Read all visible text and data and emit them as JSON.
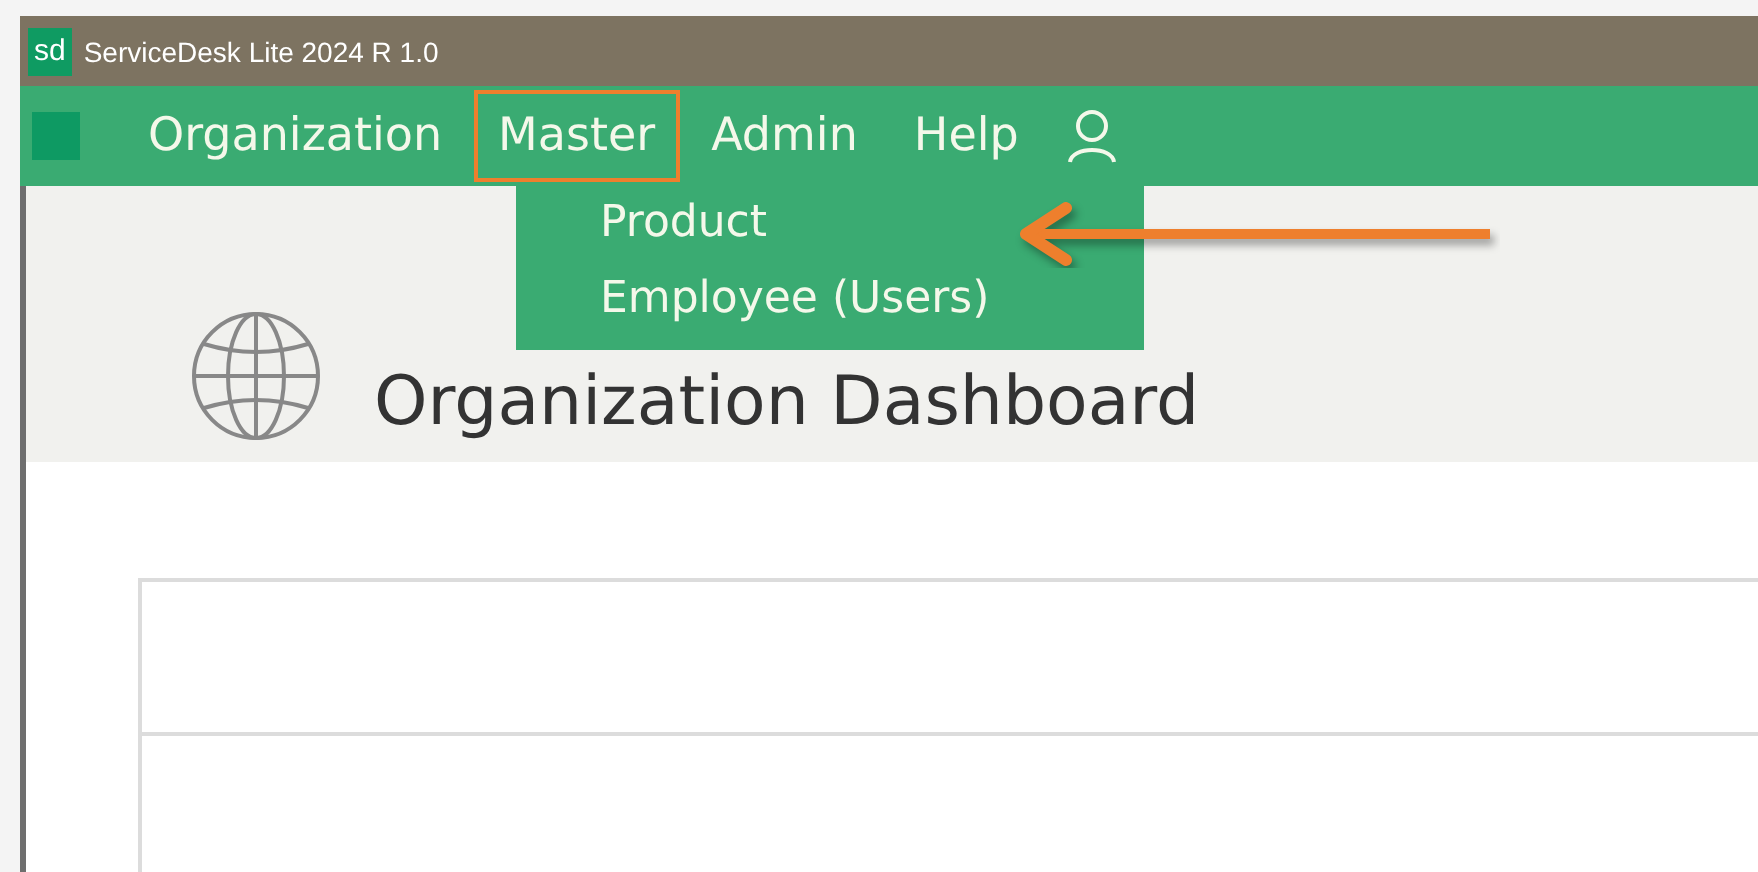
{
  "window": {
    "logo": "sd",
    "title": "ServiceDesk Lite 2024 R 1.0"
  },
  "menu": [
    {
      "label": "Organization",
      "selected": false
    },
    {
      "label": "Master",
      "selected": true
    },
    {
      "label": "Admin",
      "selected": false
    },
    {
      "label": "Help",
      "selected": false
    }
  ],
  "dropdown": {
    "items": [
      "Product",
      "Employee (Users)"
    ]
  },
  "dashboard": {
    "title": "Organization Dashboard"
  }
}
